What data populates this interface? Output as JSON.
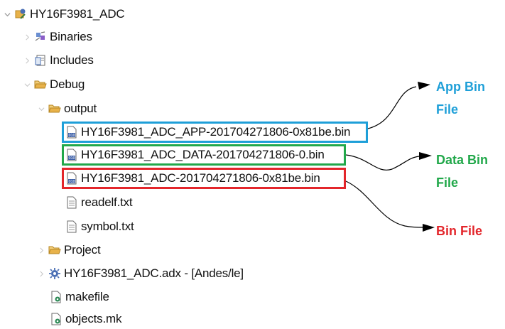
{
  "tree": {
    "project": "HY16F3981_ADC",
    "binaries": "Binaries",
    "includes": "Includes",
    "debug": "Debug",
    "output": "output",
    "app_bin": "HY16F3981_ADC_APP-201704271806-0x81be.bin",
    "data_bin": "HY16F3981_ADC_DATA-201704271806-0.bin",
    "main_bin": "HY16F3981_ADC-201704271806-0x81be.bin",
    "readelf": "readelf.txt",
    "symbol": "symbol.txt",
    "project_folder": "Project",
    "adx": "HY16F3981_ADC.adx - [Andes/le]",
    "makefile": "makefile",
    "objects": "objects.mk"
  },
  "callouts": {
    "app_line1": "App Bin",
    "app_line2": "File",
    "data_line1": "Data Bin",
    "data_line2": "File",
    "bin": "Bin File"
  },
  "colors": {
    "app": "#1e9fd8",
    "data": "#21a84a",
    "bin": "#e3262b",
    "folder": "#e8b24a",
    "chevron": "#9a9a9a"
  },
  "icons": {
    "project": "project-icon",
    "binaries": "binaries-icon",
    "includes": "includes-icon",
    "folder": "folder-open-icon",
    "bin_file": "binary-file-icon",
    "text_file": "text-file-icon",
    "adx": "gear-config-icon",
    "make": "makefile-icon"
  }
}
